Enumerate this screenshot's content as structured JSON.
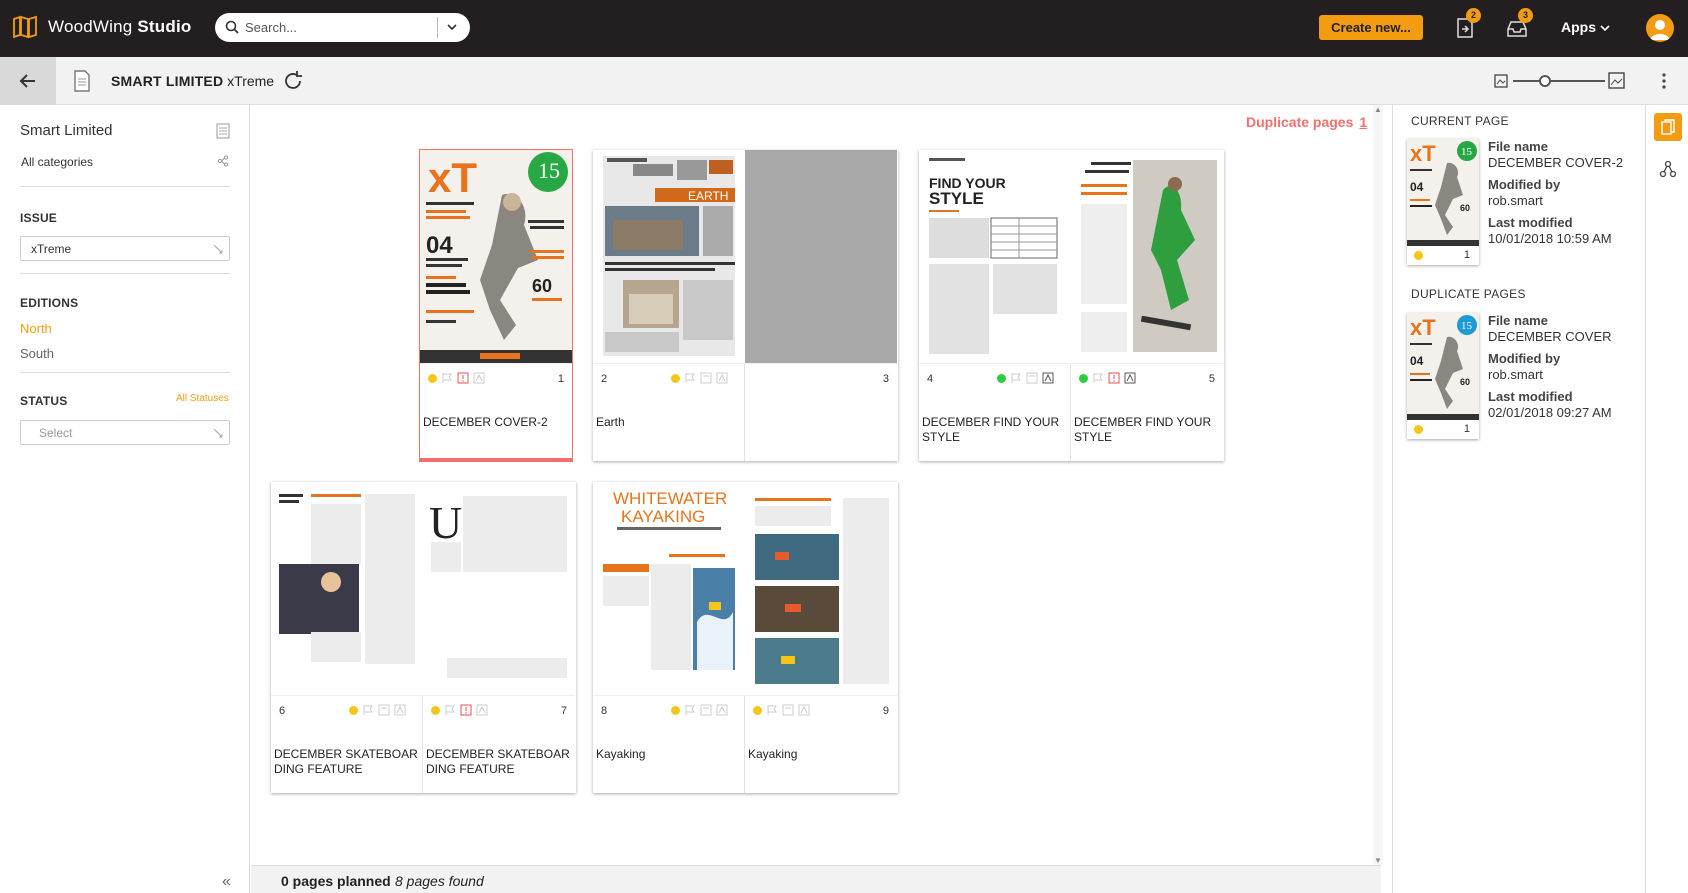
{
  "app": {
    "brand_name": "WoodWing",
    "brand_product": "Studio",
    "search_placeholder": "Search...",
    "create_label": "Create new...",
    "notify_count_1": "2",
    "notify_count_2": "3",
    "apps_label": "Apps"
  },
  "toolbar": {
    "brand_bold": "SMART LIMITED",
    "issue_name": "xTreme"
  },
  "left": {
    "brand": "Smart Limited",
    "category": "All categories",
    "issue_heading": "ISSUE",
    "issue_value": "xTreme",
    "editions_heading": "EDITIONS",
    "edition_north": "North",
    "edition_south": "South",
    "status_heading": "STATUS",
    "all_statuses": "All Statuses",
    "status_placeholder": "Select",
    "collapse": "«"
  },
  "main": {
    "duplicate_label": "Duplicate pages",
    "duplicate_count": "1",
    "planned": "0 pages planned",
    "found": "8 pages found"
  },
  "pages": [
    {
      "num": "1",
      "name": "DECEMBER COVER-2",
      "status_color": "#f5c518"
    },
    {
      "num": "2",
      "name": "Earth",
      "status_color": "#f5c518"
    },
    {
      "num": "3",
      "name": ""
    },
    {
      "num": "4",
      "name": "DECEMBER FIND YOUR STYLE",
      "status_color": "#2ecc40"
    },
    {
      "num": "5",
      "name": "DECEMBER FIND YOUR STYLE",
      "status_color": "#2ecc40"
    },
    {
      "num": "6",
      "name": "DECEMBER SKATEBOARDING FEATURE",
      "status_color": "#f5c518"
    },
    {
      "num": "7",
      "name": "DECEMBER SKATEBOARDING FEATURE",
      "status_color": "#f5c518"
    },
    {
      "num": "8",
      "name": "Kayaking",
      "status_color": "#f5c518"
    },
    {
      "num": "9",
      "name": "Kayaking",
      "status_color": "#f5c518"
    }
  ],
  "thumbs": {
    "cover_logo": "xT",
    "cover_badge": "15",
    "cover_big": "04",
    "cover_60": "60",
    "earth_title": "EARTH",
    "style_title_1": "FIND YOUR",
    "style_title_2": "STYLE",
    "kayak_title_1": "WHITEWATER",
    "kayak_title_2": "KAYAKING",
    "drop_cap": "U"
  },
  "right": {
    "current_heading": "CURRENT PAGE",
    "duplicate_heading": "DUPLICATE PAGES",
    "file_label": "File name",
    "modified_by_label": "Modified by",
    "last_modified_label": "Last modified",
    "current": {
      "file": "DECEMBER COVER-2",
      "by": "rob.smart",
      "date": "10/01/2018 10:59 AM",
      "num": "1"
    },
    "duplicate": {
      "file": "DECEMBER COVER",
      "by": "rob.smart",
      "date": "02/01/2018 09:27 AM",
      "num": "1"
    }
  },
  "colors": {
    "accent": "#f39c12",
    "topbar": "#231f20",
    "duplicate_red": "#f07070"
  }
}
